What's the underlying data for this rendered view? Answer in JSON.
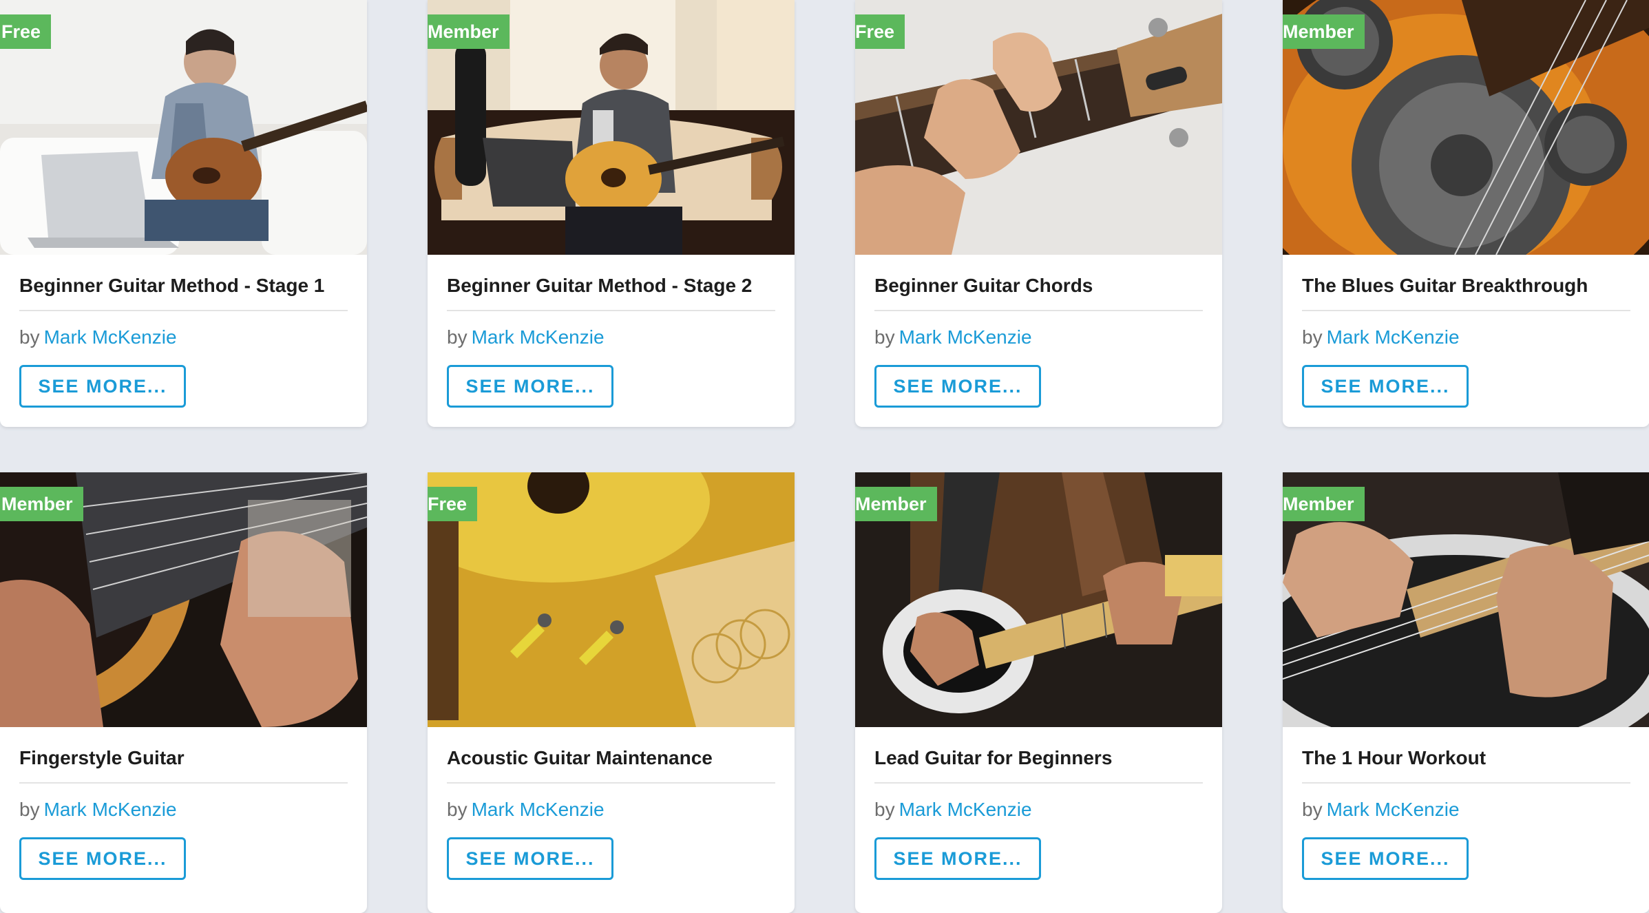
{
  "colors": {
    "badge_green": "#5cb85c",
    "link_blue": "#1a9bd7",
    "background": "#e6e9ef"
  },
  "courses": [
    {
      "badge": "Free",
      "title": "Beginner Guitar Method - Stage 1",
      "by": "by",
      "author": "Mark McKenzie",
      "button": "SEE MORE...",
      "image": "man-playing-electric-guitar-on-sofa-with-laptop"
    },
    {
      "badge": "Member",
      "title": "Beginner Guitar Method - Stage 2",
      "by": "by",
      "author": "Mark McKenzie",
      "button": "SEE MORE...",
      "image": "man-playing-acoustic-guitar-on-couch-with-laptop"
    },
    {
      "badge": "Free",
      "title": "Beginner Guitar Chords",
      "by": "by",
      "author": "Mark McKenzie",
      "button": "SEE MORE...",
      "image": "hand-forming-chord-on-guitar-neck"
    },
    {
      "badge": "Member",
      "title": "The Blues Guitar Breakthrough",
      "by": "by",
      "author": "Mark McKenzie",
      "button": "SEE MORE...",
      "image": "resonator-guitar-closeup"
    },
    {
      "badge": "Member",
      "title": "Fingerstyle Guitar",
      "by": "by",
      "author": "Mark McKenzie",
      "button": "SEE MORE...",
      "image": "hands-fingerpicking-acoustic-guitar"
    },
    {
      "badge": "Free",
      "title": "Acoustic Guitar Maintenance",
      "by": "by",
      "author": "Mark McKenzie",
      "button": "SEE MORE...",
      "image": "acoustic-guitar-with-pliers-and-strings"
    },
    {
      "badge": "Member",
      "title": "Lead Guitar for Beginners",
      "by": "by",
      "author": "Mark McKenzie",
      "button": "SEE MORE...",
      "image": "man-playing-telecaster-electric-guitar"
    },
    {
      "badge": "Member",
      "title": "The 1 Hour Workout",
      "by": "by",
      "author": "Mark McKenzie",
      "button": "SEE MORE...",
      "image": "hands-on-electric-guitar-strings"
    }
  ]
}
